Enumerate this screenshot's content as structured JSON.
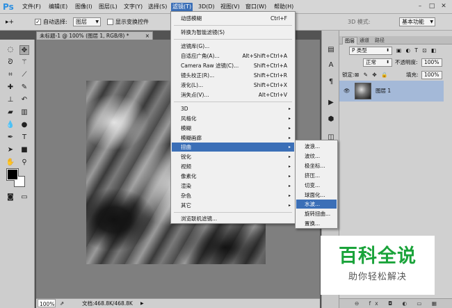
{
  "app": {
    "logo": "Ps"
  },
  "menubar": {
    "items": [
      "文件(F)",
      "编辑(E)",
      "图像(I)",
      "图层(L)",
      "文字(Y)",
      "选择(S)",
      "滤镜(T)",
      "3D(D)",
      "视图(V)",
      "窗口(W)",
      "帮助(H)"
    ],
    "active_index": 6,
    "window_buttons": [
      "–",
      "□",
      "✕"
    ]
  },
  "options": {
    "tool_glyph": "▸+",
    "auto_select_label": "自动选择:",
    "auto_select_checked": "✓",
    "auto_select_value": "图层",
    "show_transform_label": "显示变换控件",
    "mode_3d_label": "3D 模式:",
    "workspace_value": "基本功能"
  },
  "document": {
    "tab_label": "未标题-1 @ 100% (图层 1, RGB/8) *",
    "tab_close": "×",
    "zoom": "100%",
    "doc_info": "文档:468.8K/468.8K"
  },
  "filter_menu": {
    "items": [
      {
        "label": "动感模糊",
        "shortcut": "Ctrl+F"
      },
      {
        "label": "转换为智能滤镜(S)",
        "shortcut": ""
      },
      {
        "label": "滤镜库(G)...",
        "shortcut": ""
      },
      {
        "label": "自适应广角(A)...",
        "shortcut": "Alt+Shift+Ctrl+A"
      },
      {
        "label": "Camera Raw 滤镜(C)...",
        "shortcut": "Shift+Ctrl+A"
      },
      {
        "label": "镜头校正(R)...",
        "shortcut": "Shift+Ctrl+R"
      },
      {
        "label": "液化(L)...",
        "shortcut": "Shift+Ctrl+X"
      },
      {
        "label": "消失点(V)...",
        "shortcut": "Alt+Ctrl+V"
      },
      {
        "label": "3D",
        "submenu": "▸"
      },
      {
        "label": "风格化",
        "submenu": "▸"
      },
      {
        "label": "模糊",
        "submenu": "▸"
      },
      {
        "label": "模糊画廊",
        "submenu": "▸"
      },
      {
        "label": "扭曲",
        "submenu": "▸"
      },
      {
        "label": "锐化",
        "submenu": "▸"
      },
      {
        "label": "视频",
        "submenu": "▸"
      },
      {
        "label": "像素化",
        "submenu": "▸"
      },
      {
        "label": "渲染",
        "submenu": "▸"
      },
      {
        "label": "杂色",
        "submenu": "▸"
      },
      {
        "label": "其它",
        "submenu": "▸"
      },
      {
        "label": "浏览联机滤镜...",
        "shortcut": ""
      }
    ],
    "highlighted_index": 12
  },
  "distort_menu": {
    "items": [
      "波浪...",
      "波纹...",
      "极坐标...",
      "挤压...",
      "切变...",
      "球面化...",
      "水波...",
      "旋转扭曲...",
      "置换..."
    ],
    "highlighted_index": 6
  },
  "layers_panel": {
    "tabs": [
      "图层",
      "通道",
      "路径"
    ],
    "filter_kind": "P 类型",
    "filter_icons": "▣ ◐ T ⊡ ◧",
    "blend_mode": "正常",
    "opacity_label": "不透明度:",
    "opacity_value": "100%",
    "lock_label": "锁定:",
    "lock_icons": "⊠ ✎ ✥ 🔒",
    "fill_label": "填充:",
    "fill_value": "100%",
    "layer_name": "图层 1",
    "eye_glyph": "👁",
    "footer_icons": "⊖ fx ◘ ◐ ▭ ▦ 🗑"
  },
  "watermark": {
    "title": "百科全说",
    "subtitle": "助你轻松解决"
  },
  "colors": {
    "accent": "#3b6fb7",
    "watermark_green": "#1aa33a"
  }
}
